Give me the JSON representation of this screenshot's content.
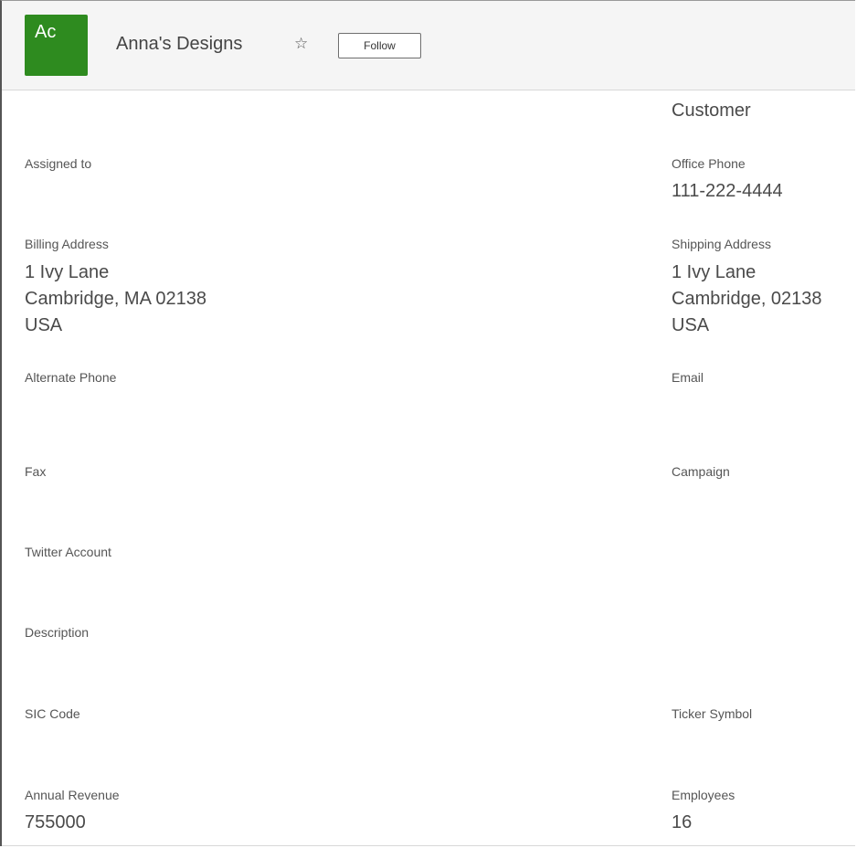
{
  "header": {
    "avatar_initials": "Ac",
    "avatar_color": "#2e8b1f",
    "record_name": "Anna's Designs",
    "star_icon": "star-outline-icon",
    "follow_label": "Follow"
  },
  "fields": {
    "type": {
      "value": "Customer"
    },
    "assigned_to": {
      "label": "Assigned to",
      "value": ""
    },
    "office_phone": {
      "label": "Office Phone",
      "value": "111-222-4444"
    },
    "billing_address": {
      "label": "Billing Address",
      "lines": [
        "1 Ivy Lane",
        "Cambridge, MA  02138",
        "USA"
      ]
    },
    "shipping_address": {
      "label": "Shipping Address",
      "lines": [
        "1 Ivy Lane",
        "Cambridge, 02138",
        "USA"
      ]
    },
    "alternate_phone": {
      "label": "Alternate Phone",
      "value": ""
    },
    "email": {
      "label": "Email",
      "value": ""
    },
    "fax": {
      "label": "Fax",
      "value": ""
    },
    "campaign": {
      "label": "Campaign",
      "value": ""
    },
    "twitter_account": {
      "label": "Twitter Account",
      "value": ""
    },
    "description": {
      "label": "Description",
      "value": ""
    },
    "sic_code": {
      "label": "SIC Code",
      "value": ""
    },
    "ticker_symbol": {
      "label": "Ticker Symbol",
      "value": ""
    },
    "annual_revenue": {
      "label": "Annual Revenue",
      "value": "755000"
    },
    "employees": {
      "label": "Employees",
      "value": "16"
    }
  }
}
